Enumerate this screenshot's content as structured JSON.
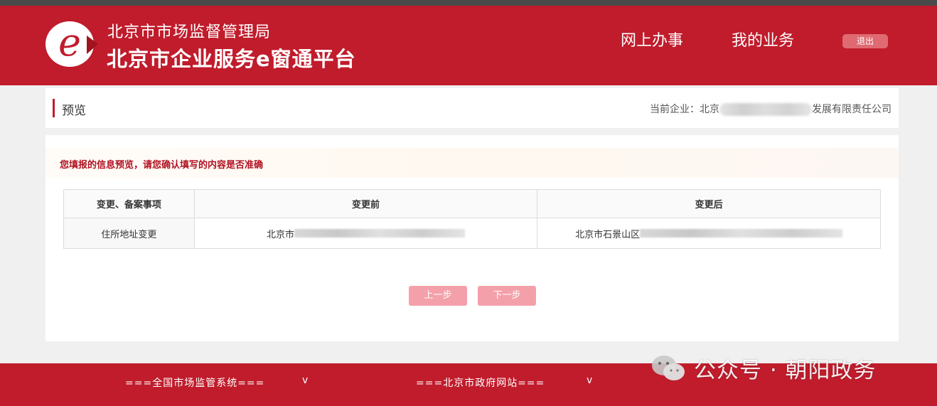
{
  "header": {
    "org_name": "北京市市场监督管理局",
    "platform_name": "北京市企业服务e窗通平台",
    "nav": [
      {
        "label": "网上办事"
      },
      {
        "label": "我的业务"
      }
    ],
    "logout_label": "退出"
  },
  "title_bar": {
    "title": "预览",
    "company_prefix": "当前企业：北京",
    "company_suffix": "发展有限责任公司"
  },
  "content": {
    "notice": "您填报的信息预览，请您确认填写的内容是否准确",
    "table": {
      "headers": [
        "变更、备案事项",
        "变更前",
        "变更后"
      ],
      "rows": [
        {
          "item": "住所地址变更",
          "before": "北京市",
          "after": "北京市石景山区"
        }
      ]
    },
    "buttons": {
      "prev": "上一步",
      "next": "下一步"
    }
  },
  "footer": {
    "select1": "===全国市场监管系统===",
    "select2": "===北京市政府网站===",
    "chevron": "v"
  },
  "watermark": {
    "text": "公众号 · 朝阳政务"
  },
  "colors": {
    "brand_red": "#c01c2c",
    "button_pink": "#f4a0aa",
    "notice_red": "#b01020"
  }
}
